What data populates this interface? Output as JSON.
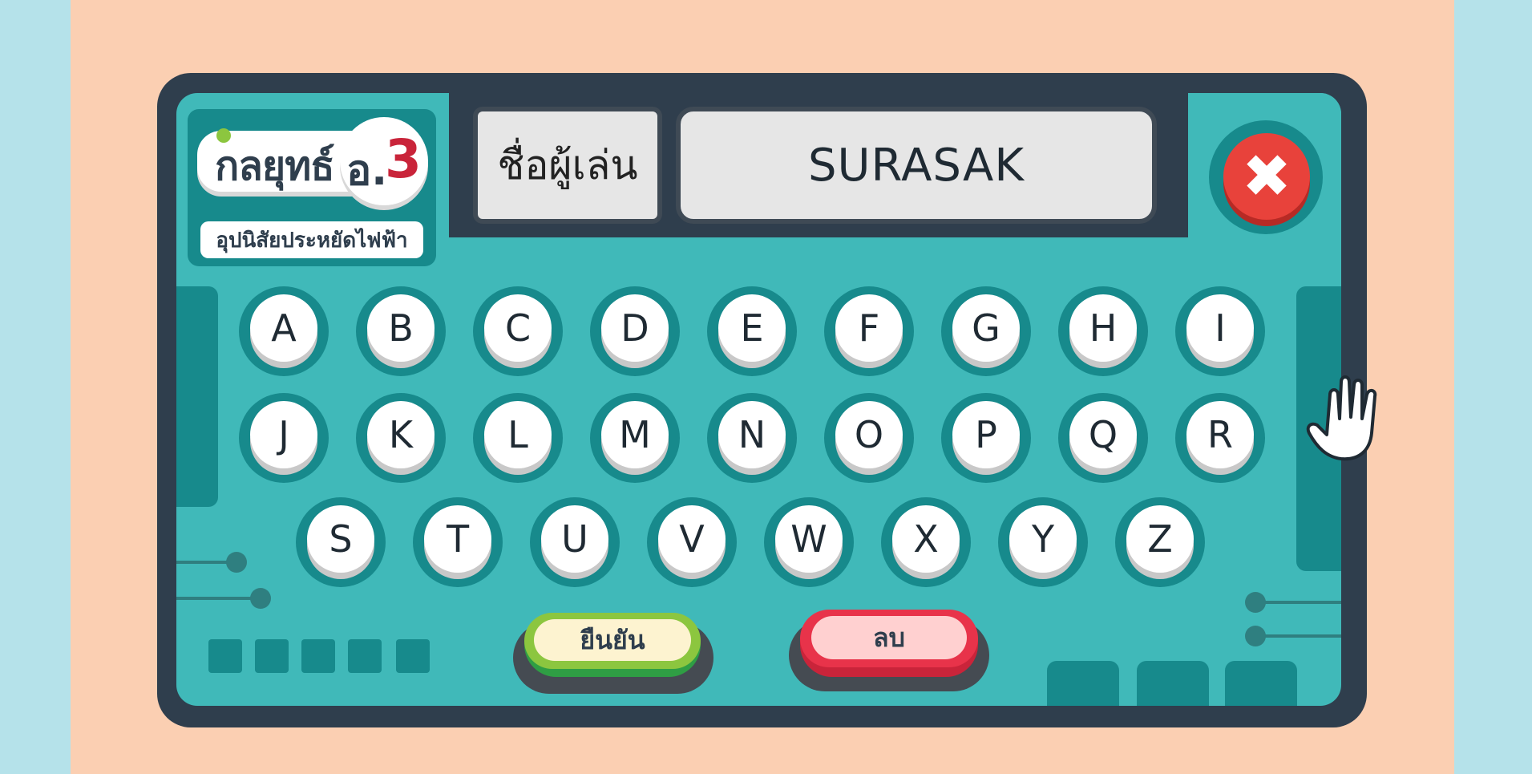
{
  "logo": {
    "title": "กลยุทธ์",
    "o_label": "อ.",
    "number": "3",
    "subtitle": "อุปนิสัยประหยัดไฟฟ้า"
  },
  "player": {
    "label": "ชื่อผู้เล่น",
    "name": "SURASAK"
  },
  "close": {
    "symbol": "✖"
  },
  "keyboard": {
    "row1": [
      "A",
      "B",
      "C",
      "D",
      "E",
      "F",
      "G",
      "H",
      "I"
    ],
    "row2": [
      "J",
      "K",
      "L",
      "M",
      "N",
      "O",
      "P",
      "Q",
      "R"
    ],
    "row3": [
      "S",
      "T",
      "U",
      "V",
      "W",
      "X",
      "Y",
      "Z"
    ]
  },
  "actions": {
    "confirm_label": "ยืนยัน",
    "delete_label": "ลบ"
  },
  "colors": {
    "frame": "#2f3e4d",
    "panel": "#40b9b9",
    "accent_dark": "#178a8c",
    "close": "#e8423b",
    "confirm": "#8cc63f",
    "delete": "#e8334a",
    "stage_bg": "#fbcfb2",
    "outer_bg": "#b5e2ea"
  }
}
